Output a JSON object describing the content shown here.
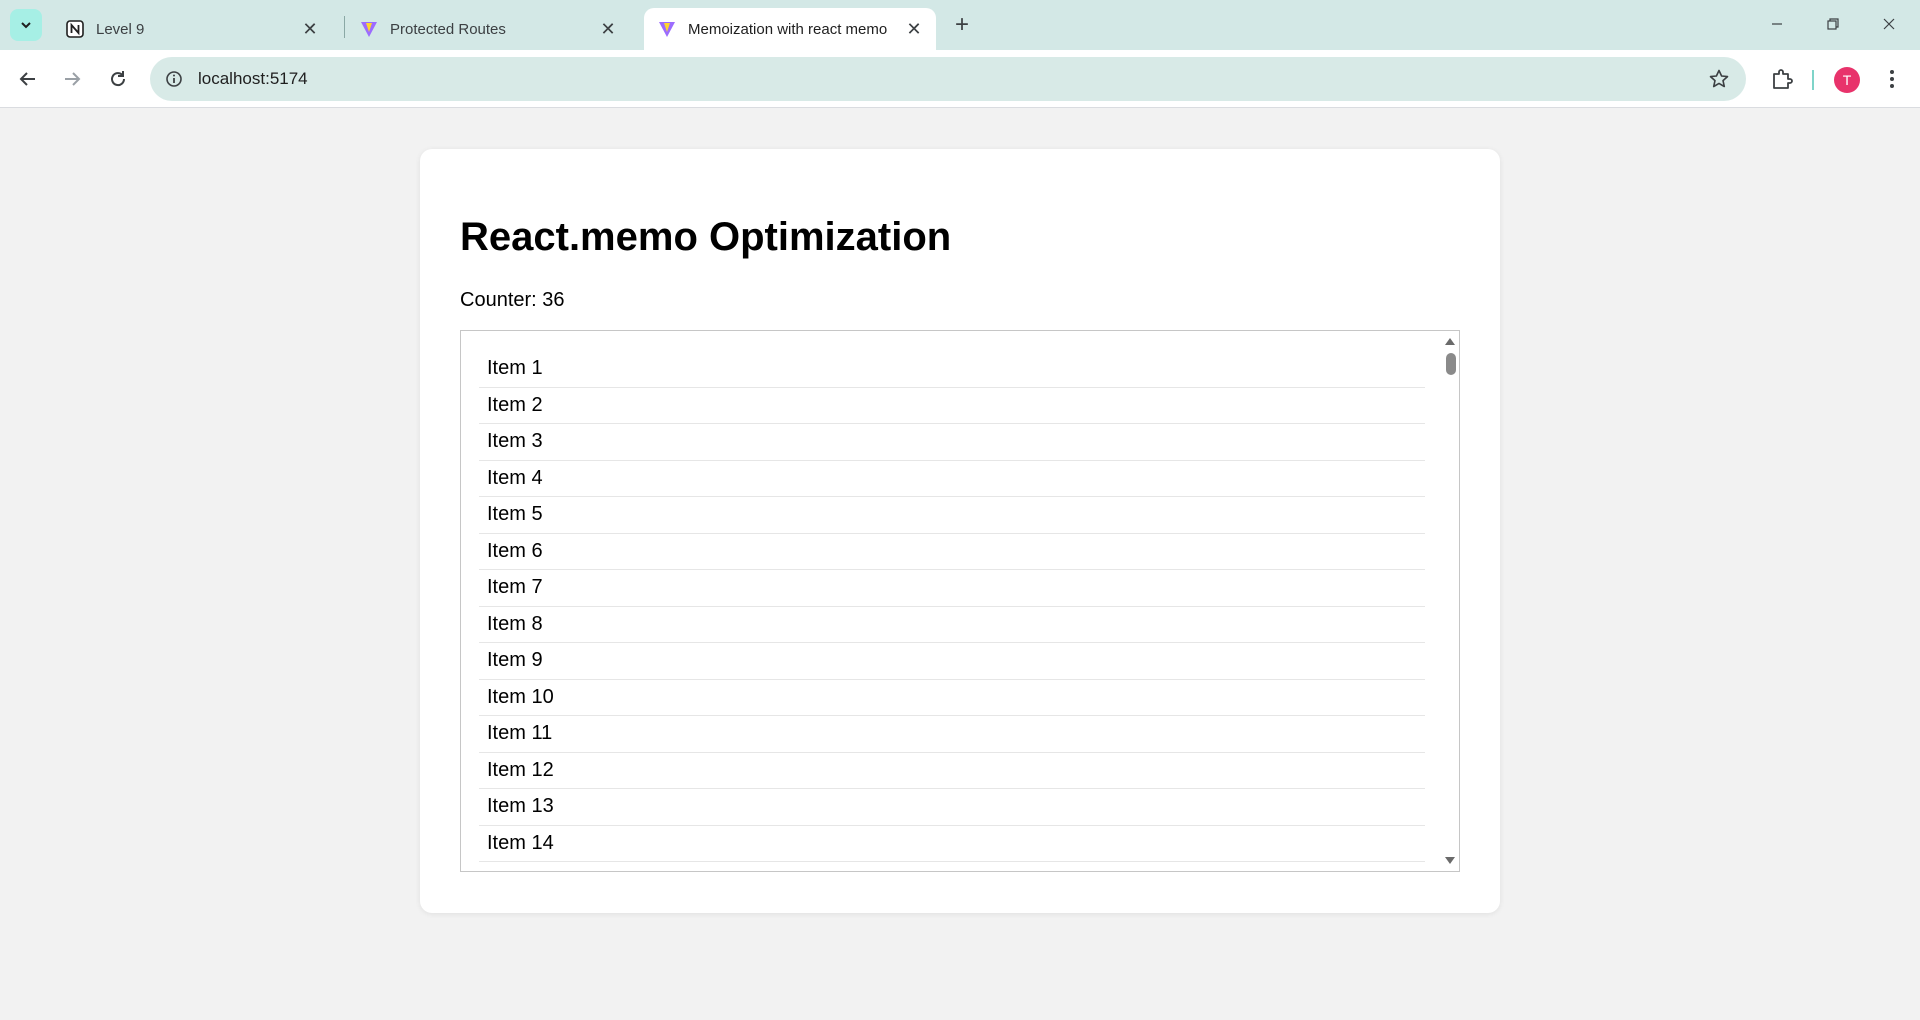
{
  "browser": {
    "tabs": [
      {
        "title": "Level 9",
        "icon": "notion-icon",
        "active": false
      },
      {
        "title": "Protected Routes",
        "icon": "vite-icon",
        "active": false
      },
      {
        "title": "Memoization with react memo",
        "icon": "vite-icon",
        "active": true
      }
    ],
    "url": "localhost:5174",
    "profile_initial": "T",
    "accent_color": "#d3e8e6",
    "profile_color": "#e8336b"
  },
  "page": {
    "title": "React.memo Optimization",
    "counter_text": "Counter: 36",
    "items": [
      "Item 1",
      "Item 2",
      "Item 3",
      "Item 4",
      "Item 5",
      "Item 6",
      "Item 7",
      "Item 8",
      "Item 9",
      "Item 10",
      "Item 11",
      "Item 12",
      "Item 13",
      "Item 14"
    ]
  }
}
